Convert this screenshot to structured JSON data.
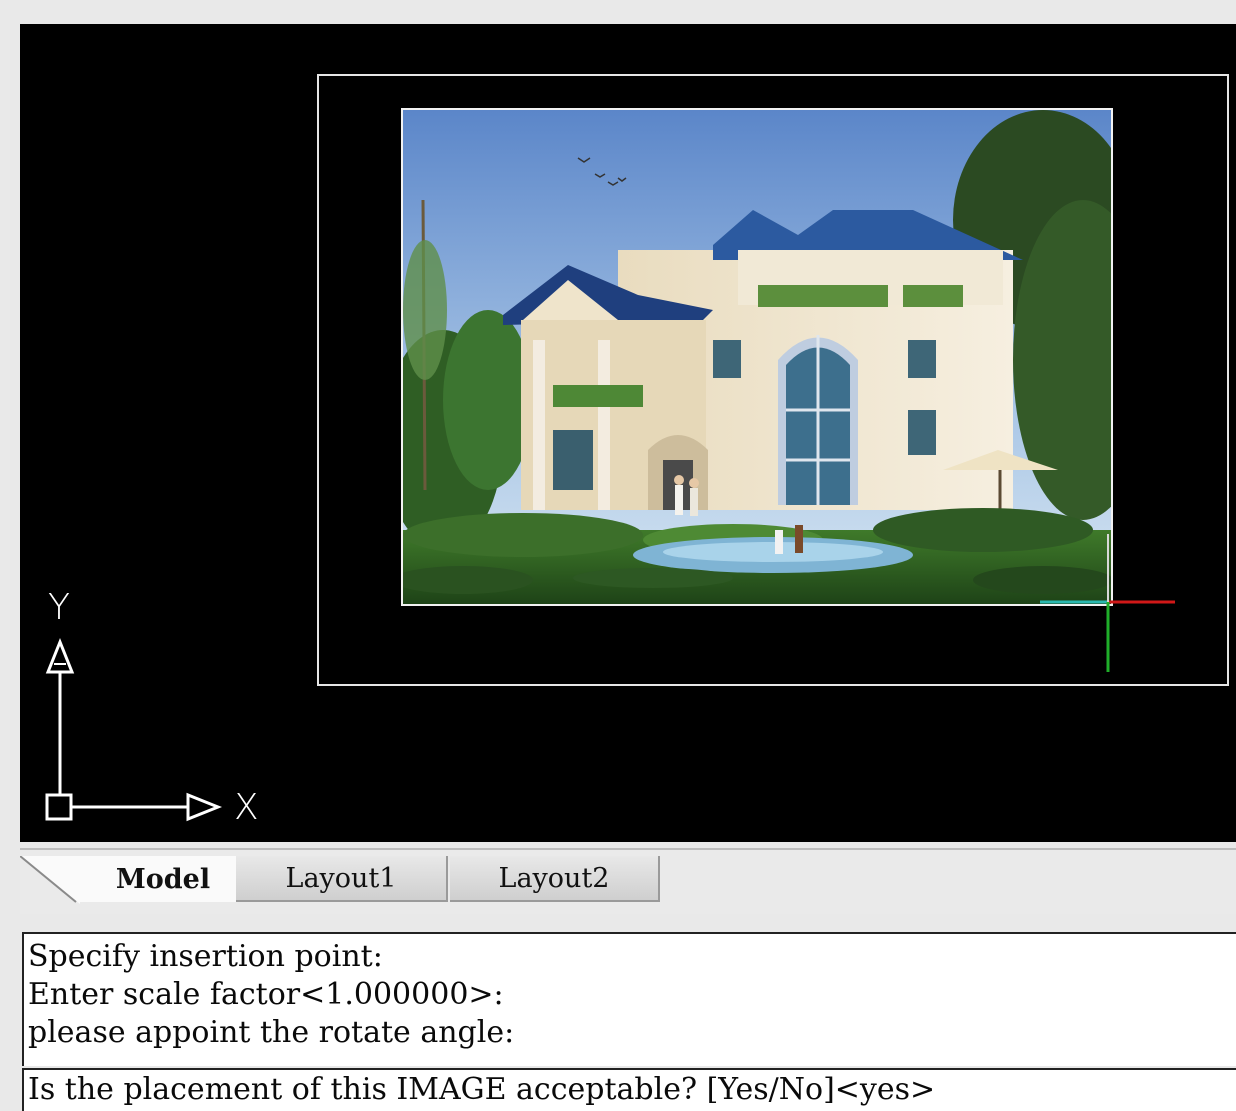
{
  "ucs": {
    "x_label": "X",
    "y_label": "Y"
  },
  "raster_image": {
    "description_icon": "house-rendering-image"
  },
  "tabs": [
    {
      "label": "Model",
      "active": true
    },
    {
      "label": "Layout1",
      "active": false
    },
    {
      "label": "Layout2",
      "active": false
    }
  ],
  "command_history": [
    "Specify insertion point:",
    "Enter scale factor<1.000000>:",
    "please appoint the rotate angle:"
  ],
  "command_prompt": "Is the placement of this IMAGE acceptable? [Yes/No]<yes>",
  "colors": {
    "canvas_bg": "#000000",
    "crosshair_x": "#d01818",
    "crosshair_y": "#1fae2a",
    "frame": "#e6e6e6"
  }
}
